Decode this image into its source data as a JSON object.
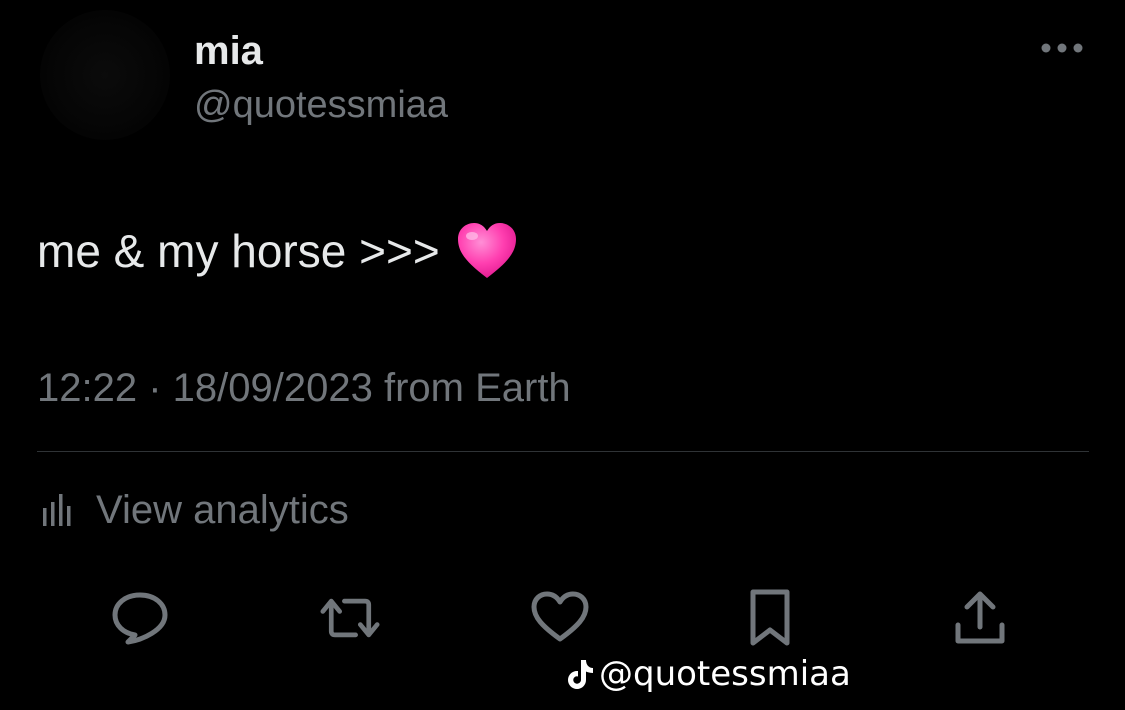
{
  "author": {
    "display_name": "mia",
    "handle": "@quotessmiaa"
  },
  "tweet": {
    "text": "me & my horse >>>",
    "emoji": "pink-heart",
    "timestamp": "12:22 · 18/09/2023 from Earth"
  },
  "analytics": {
    "label": "View analytics"
  },
  "actions": [
    {
      "name": "reply",
      "icon": "speech-bubble-icon"
    },
    {
      "name": "repost",
      "icon": "repost-arrows-icon"
    },
    {
      "name": "like",
      "icon": "heart-outline-icon"
    },
    {
      "name": "bookmark",
      "icon": "bookmark-icon"
    },
    {
      "name": "share",
      "icon": "share-upload-icon"
    }
  ],
  "watermark": {
    "icon": "tiktok-logo-icon",
    "text": "@quotessmiaa"
  },
  "colors": {
    "background": "#000000",
    "primary_text": "#e7e9ea",
    "secondary_text": "#71767b",
    "divider": "#2f3336",
    "emoji_pink": "#ff4fb8"
  }
}
